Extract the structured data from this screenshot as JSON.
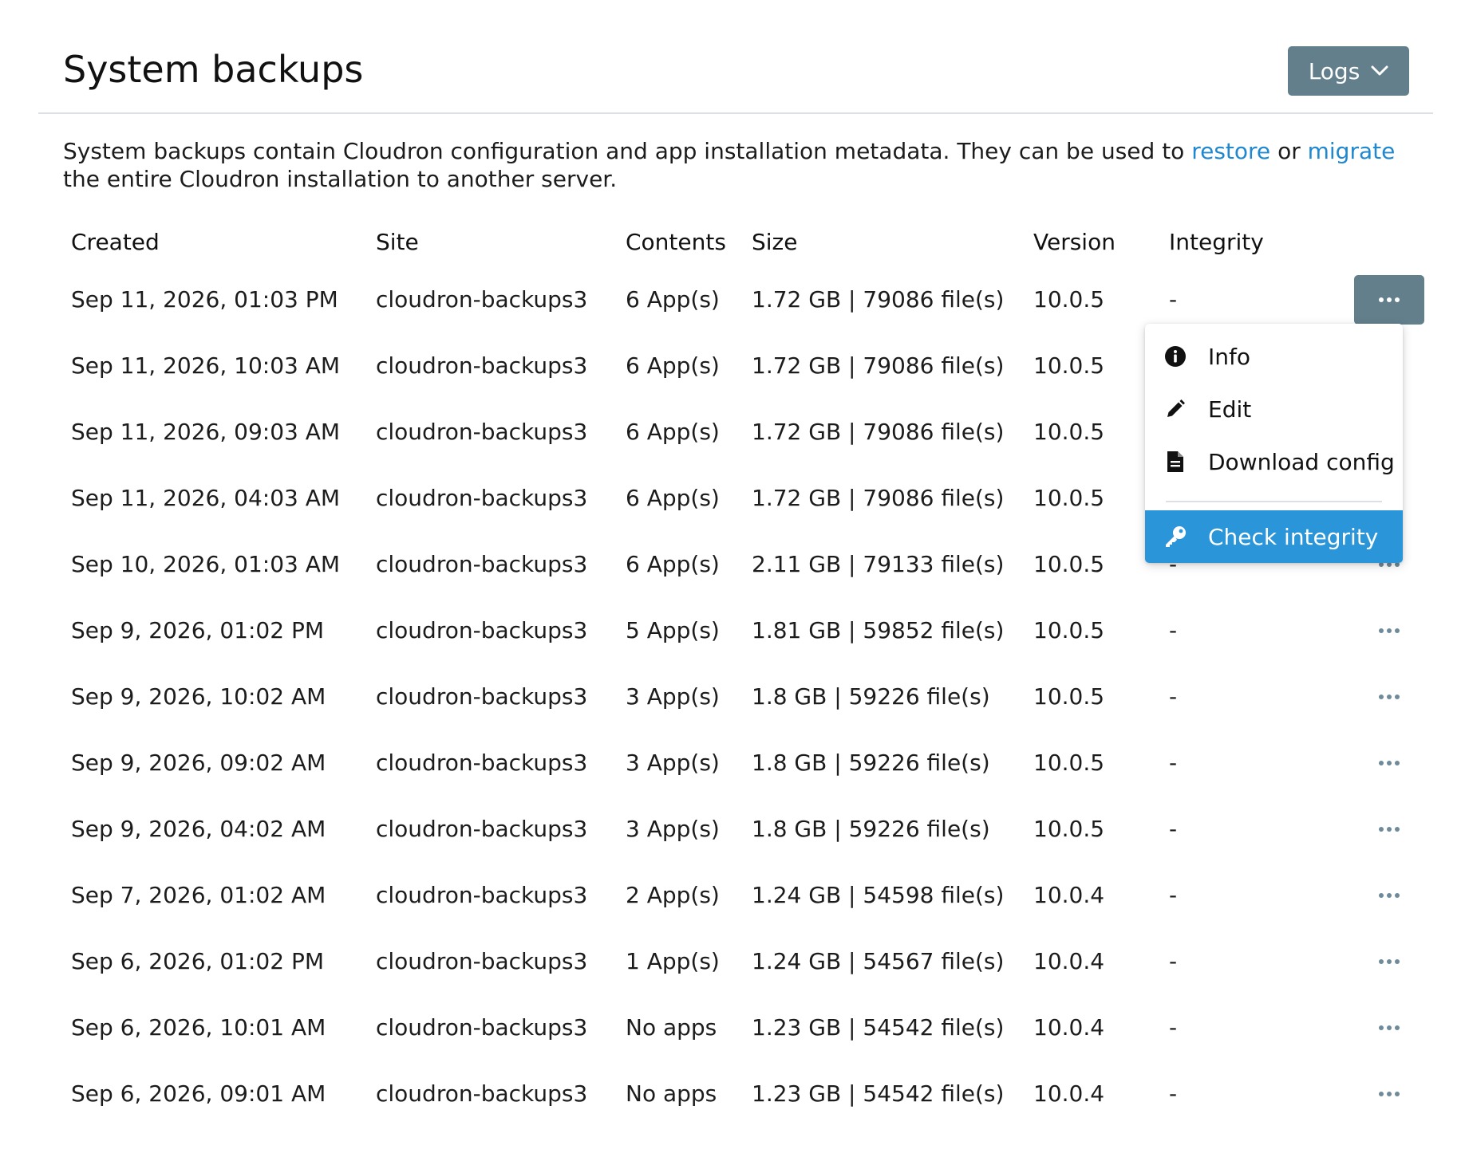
{
  "header": {
    "title": "System backups",
    "logs_label": "Logs"
  },
  "description": {
    "before": "System backups contain Cloudron configuration and app installation metadata. They can be used to ",
    "restore_link": "restore",
    "between": " or ",
    "migrate_link": "migrate",
    "after": " the entire Cloudron installation to another server."
  },
  "table": {
    "columns": [
      "Created",
      "Site",
      "Contents",
      "Size",
      "Version",
      "Integrity"
    ],
    "rows": [
      {
        "created": "Sep 11, 2026, 01:03 PM",
        "site": "cloudron-backups3",
        "contents": "6 App(s)",
        "size": "1.72 GB | 79086 file(s)",
        "version": "10.0.5",
        "integrity": "-"
      },
      {
        "created": "Sep 11, 2026, 10:03 AM",
        "site": "cloudron-backups3",
        "contents": "6 App(s)",
        "size": "1.72 GB | 79086 file(s)",
        "version": "10.0.5",
        "integrity": "-"
      },
      {
        "created": "Sep 11, 2026, 09:03 AM",
        "site": "cloudron-backups3",
        "contents": "6 App(s)",
        "size": "1.72 GB | 79086 file(s)",
        "version": "10.0.5",
        "integrity": "-"
      },
      {
        "created": "Sep 11, 2026, 04:03 AM",
        "site": "cloudron-backups3",
        "contents": "6 App(s)",
        "size": "1.72 GB | 79086 file(s)",
        "version": "10.0.5",
        "integrity": "-"
      },
      {
        "created": "Sep 10, 2026, 01:03 AM",
        "site": "cloudron-backups3",
        "contents": "6 App(s)",
        "size": "2.11 GB | 79133 file(s)",
        "version": "10.0.5",
        "integrity": "-"
      },
      {
        "created": "Sep 9, 2026, 01:02 PM",
        "site": "cloudron-backups3",
        "contents": "5 App(s)",
        "size": "1.81 GB | 59852 file(s)",
        "version": "10.0.5",
        "integrity": "-"
      },
      {
        "created": "Sep 9, 2026, 10:02 AM",
        "site": "cloudron-backups3",
        "contents": "3 App(s)",
        "size": "1.8 GB | 59226 file(s)",
        "version": "10.0.5",
        "integrity": "-"
      },
      {
        "created": "Sep 9, 2026, 09:02 AM",
        "site": "cloudron-backups3",
        "contents": "3 App(s)",
        "size": "1.8 GB | 59226 file(s)",
        "version": "10.0.5",
        "integrity": "-"
      },
      {
        "created": "Sep 9, 2026, 04:02 AM",
        "site": "cloudron-backups3",
        "contents": "3 App(s)",
        "size": "1.8 GB | 59226 file(s)",
        "version": "10.0.5",
        "integrity": "-"
      },
      {
        "created": "Sep 7, 2026, 01:02 AM",
        "site": "cloudron-backups3",
        "contents": "2 App(s)",
        "size": "1.24 GB | 54598 file(s)",
        "version": "10.0.4",
        "integrity": "-"
      },
      {
        "created": "Sep 6, 2026, 01:02 PM",
        "site": "cloudron-backups3",
        "contents": "1 App(s)",
        "size": "1.24 GB | 54567 file(s)",
        "version": "10.0.4",
        "integrity": "-"
      },
      {
        "created": "Sep 6, 2026, 10:01 AM",
        "site": "cloudron-backups3",
        "contents": "No apps",
        "size": "1.23 GB | 54542 file(s)",
        "version": "10.0.4",
        "integrity": "-"
      },
      {
        "created": "Sep 6, 2026, 09:01 AM",
        "site": "cloudron-backups3",
        "contents": "No apps",
        "size": "1.23 GB | 54542 file(s)",
        "version": "10.0.4",
        "integrity": "-"
      }
    ]
  },
  "menu": {
    "items": [
      {
        "label": "Info",
        "icon": "info-icon"
      },
      {
        "label": "Edit",
        "icon": "pencil-icon"
      },
      {
        "label": "Download config",
        "icon": "file-icon"
      }
    ],
    "check_integrity": {
      "label": "Check integrity",
      "icon": "key-icon"
    }
  },
  "colors": {
    "primary_button": "#637f8c",
    "link": "#1f88cf",
    "menu_highlight": "#2b95d9"
  }
}
